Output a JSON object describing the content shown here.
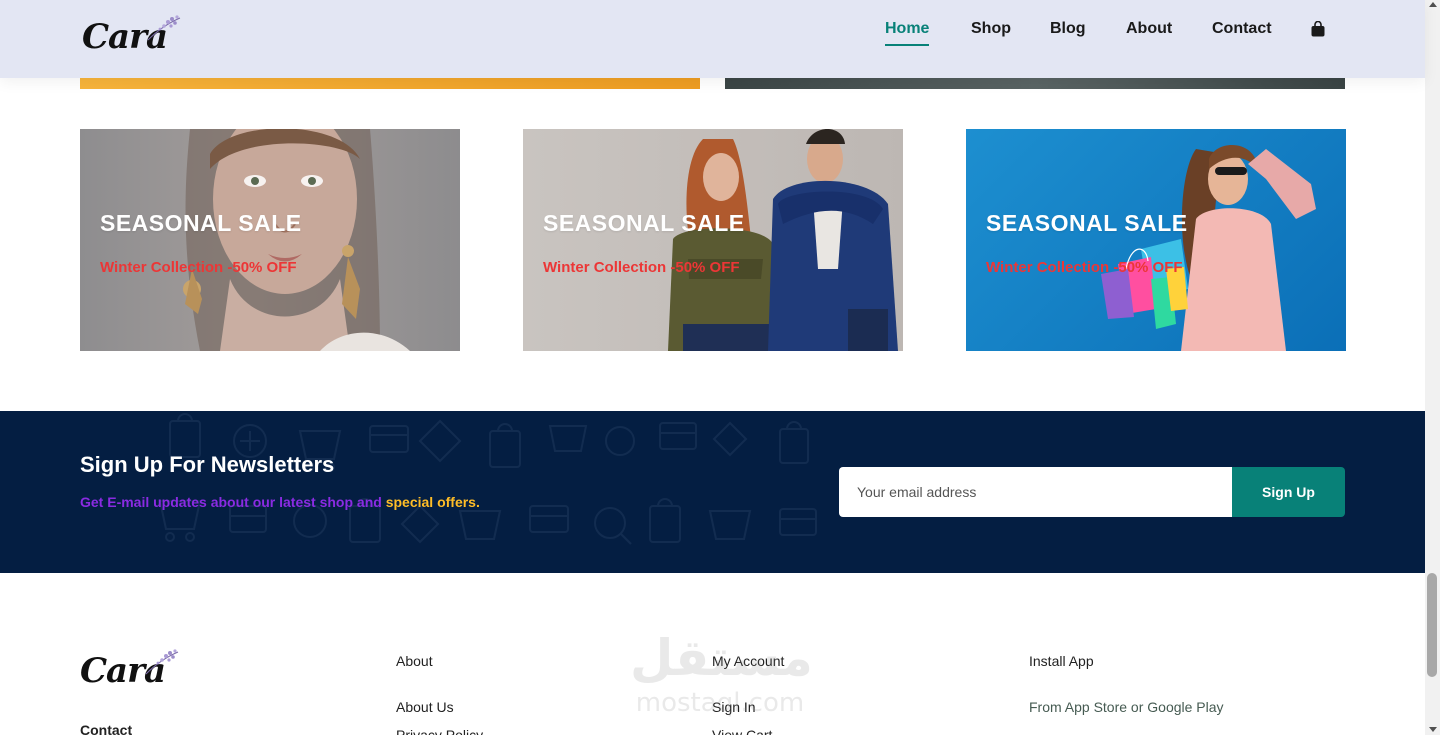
{
  "header": {
    "logo_text": "Cara",
    "nav": [
      {
        "label": "Home",
        "active": true
      },
      {
        "label": "Shop",
        "active": false
      },
      {
        "label": "Blog",
        "active": false
      },
      {
        "label": "About",
        "active": false
      },
      {
        "label": "Contact",
        "active": false
      }
    ],
    "cart_icon": "shopping-bag-icon"
  },
  "banners": [
    {
      "title": "SEASONAL SALE",
      "subtitle": "Winter Collection -50% OFF",
      "image": "woman-with-earrings"
    },
    {
      "title": "SEASONAL SALE",
      "subtitle": "Winter Collection -50% OFF",
      "image": "couple-in-jackets"
    },
    {
      "title": "SEASONAL SALE",
      "subtitle": "Winter Collection -50% OFF",
      "image": "woman-with-shopping-bags"
    }
  ],
  "newsletter": {
    "title": "Sign Up For Newsletters",
    "subtitle_part1": "Get E-mail updates about our latest shop and ",
    "subtitle_part2": "special offers.",
    "email_placeholder": "Your email address",
    "button_label": "Sign Up"
  },
  "footer": {
    "logo_text": "Cara",
    "contact_heading": "Contact",
    "columns": [
      {
        "title": "About",
        "links": [
          "About Us",
          "Privacy Policy"
        ]
      },
      {
        "title": "My Account",
        "links": [
          "Sign In",
          "View Cart"
        ]
      },
      {
        "title": "Install App",
        "links": [
          "From App Store or Google Play"
        ]
      }
    ]
  },
  "watermark": {
    "arabic": "مستقل",
    "latin": "mostaql.com"
  },
  "colors": {
    "header_bg": "#e3e6f3",
    "accent": "#088178",
    "newsletter_bg": "#041e42",
    "sale_red": "#ec3636",
    "purple": "#8a2be2",
    "gold": "#ffbd27"
  }
}
